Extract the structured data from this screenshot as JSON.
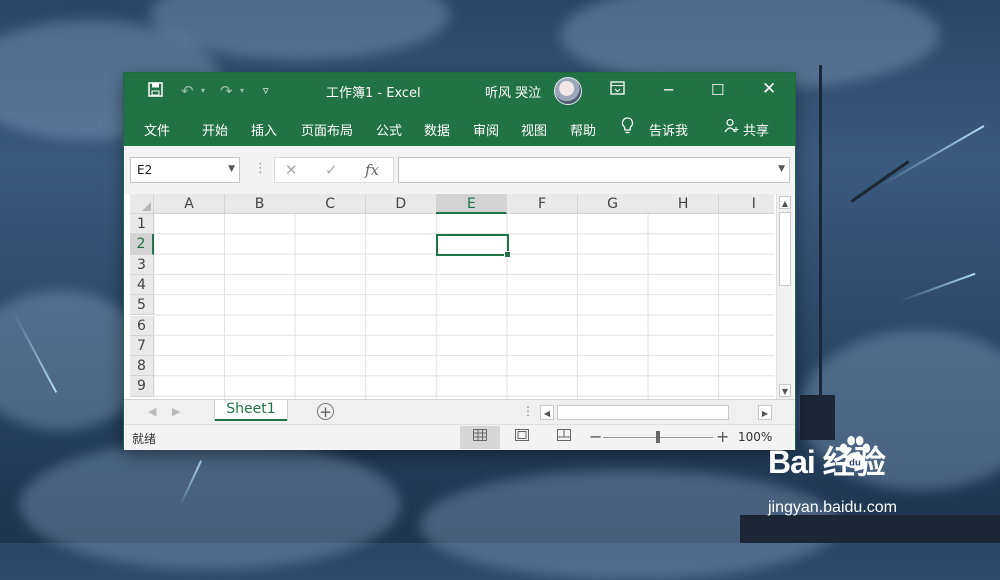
{
  "window": {
    "title": "工作簿1 - Excel",
    "user": "听风 哭泣",
    "accent_color": "#217346"
  },
  "quick_access": {
    "icons": [
      "save-icon",
      "undo-icon",
      "redo-icon",
      "customize-icon"
    ]
  },
  "controls": [
    "ribbon-display-icon",
    "minimize-icon",
    "maximize-icon",
    "close-icon"
  ],
  "ribbon": {
    "tabs": [
      "文件",
      "开始",
      "插入",
      "页面布局",
      "公式",
      "数据",
      "审阅",
      "视图",
      "帮助"
    ],
    "tell_me": "告诉我",
    "share": "共享"
  },
  "formula_bar": {
    "name_box": "E2",
    "formula": ""
  },
  "grid": {
    "columns": [
      "A",
      "B",
      "C",
      "D",
      "E",
      "F",
      "G",
      "H",
      "I"
    ],
    "rows": [
      "1",
      "2",
      "3",
      "4",
      "5",
      "6",
      "7",
      "8",
      "9"
    ],
    "selected_cell": "E2"
  },
  "sheets": {
    "tabs": [
      "Sheet1"
    ],
    "active": "Sheet1"
  },
  "status": {
    "text": "就绪",
    "zoom": "100%"
  },
  "watermark": {
    "logo": "Bai  经验",
    "logo_du": "du",
    "url": "jingyan.baidu.com"
  }
}
